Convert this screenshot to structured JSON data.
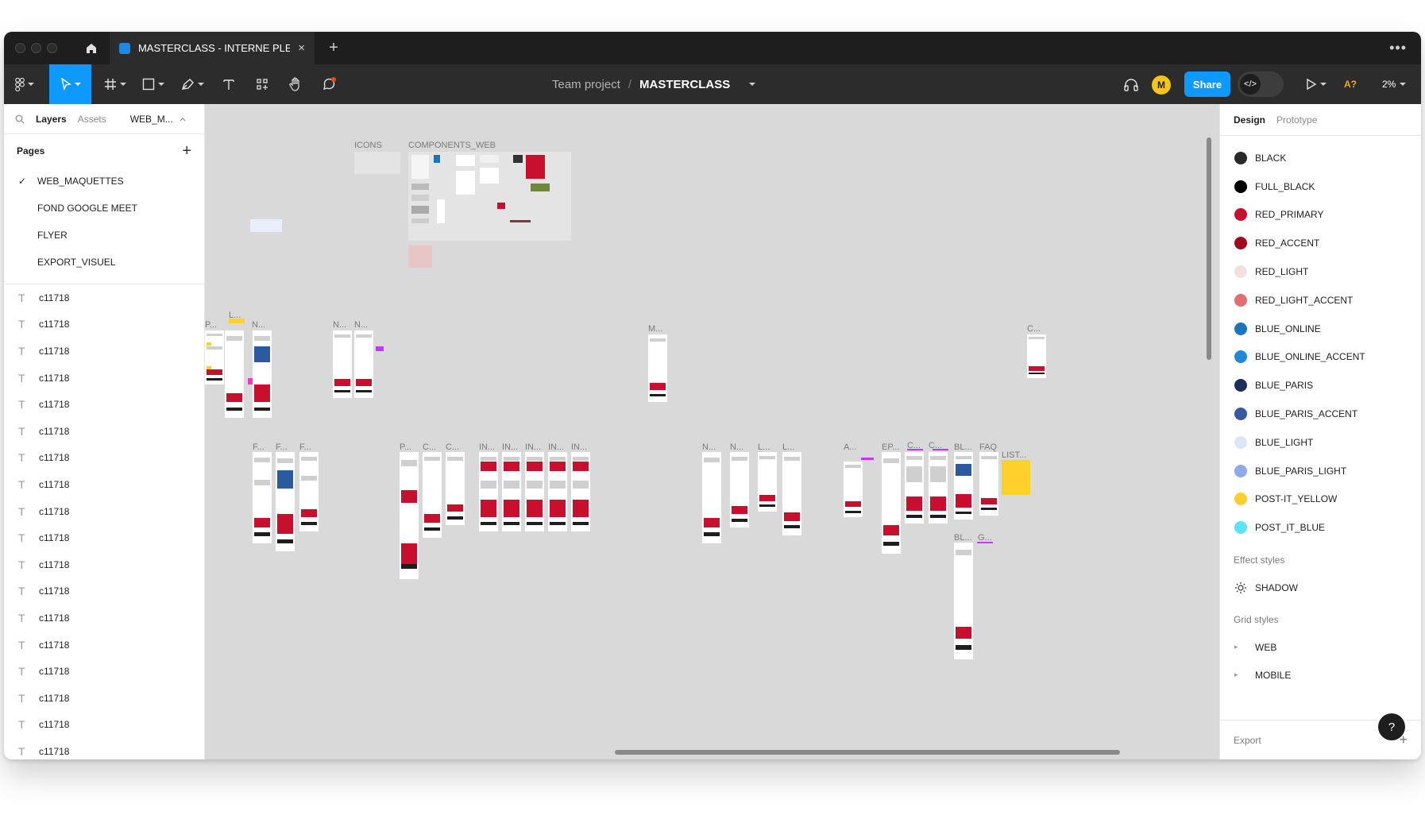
{
  "tab": {
    "title": "MASTERCLASS - INTERNE PLEASE",
    "close": "×",
    "new_tab": "+"
  },
  "titlebar": {
    "more": "•••"
  },
  "breadcrumb": {
    "team": "Team project",
    "separator": "/",
    "file": "MASTERCLASS"
  },
  "toolbar": {
    "avatar_initial": "M",
    "share_label": "Share",
    "dev_mode_icon": "</>",
    "a_label": "A?",
    "zoom_label": "2%"
  },
  "left_panel": {
    "tabs": {
      "layers": "Layers",
      "assets": "Assets",
      "page_select": "WEB_M..."
    },
    "pages_title": "Pages",
    "pages_add": "+",
    "pages": [
      {
        "label": "WEB_MAQUETTES",
        "current": true
      },
      {
        "label": "FOND GOOGLE MEET",
        "current": false
      },
      {
        "label": "FLYER",
        "current": false
      },
      {
        "label": "EXPORT_VISUEL",
        "current": false
      }
    ],
    "layers": [
      "c11718",
      "c11718",
      "c11718",
      "c11718",
      "c11718",
      "c11718",
      "c11718",
      "c11718",
      "c11718",
      "c11718",
      "c11718",
      "c11718",
      "c11718",
      "c11718",
      "c11718",
      "c11718",
      "c11718",
      "c11718"
    ]
  },
  "canvas": {
    "labels": [
      "ICONS",
      "COMPONENTS_WEB",
      "P...",
      "L...",
      "N...",
      "N...",
      "N...",
      "M...",
      "C...",
      "F...",
      "F...",
      "F...",
      "P...",
      "C...",
      "C...",
      "IN...",
      "IN...",
      "IN...",
      "IN...",
      "IN...",
      "N...",
      "N...",
      "L...",
      "L...",
      "A...",
      "EP...",
      "C...",
      "C...",
      "BL...",
      "FAQ",
      "LIST...",
      "BL...",
      "G..."
    ]
  },
  "right_panel": {
    "tabs": {
      "design": "Design",
      "prototype": "Prototype"
    },
    "colors": [
      {
        "name": "BLACK",
        "hex": "#2a2a2a"
      },
      {
        "name": "FULL_BLACK",
        "hex": "#000000"
      },
      {
        "name": "RED_PRIMARY",
        "hex": "#c8102e"
      },
      {
        "name": "RED_ACCENT",
        "hex": "#9e0b1f"
      },
      {
        "name": "RED_LIGHT",
        "hex": "#f7dede"
      },
      {
        "name": "RED_LIGHT_ACCENT",
        "hex": "#e07070"
      },
      {
        "name": "BLUE_ONLINE",
        "hex": "#1b75bc"
      },
      {
        "name": "BLUE_ONLINE_ACCENT",
        "hex": "#2389d6"
      },
      {
        "name": "BLUE_PARIS",
        "hex": "#1c2f5c"
      },
      {
        "name": "BLUE_PARIS_ACCENT",
        "hex": "#3a5aa0"
      },
      {
        "name": "BLUE_LIGHT",
        "hex": "#dbe6fb"
      },
      {
        "name": "BLUE_PARIS_LIGHT",
        "hex": "#8fa8ee"
      },
      {
        "name": "POST-IT_YELLOW",
        "hex": "#ffd02b"
      },
      {
        "name": "POST_IT_BLUE",
        "hex": "#5ce3ff"
      }
    ],
    "effect_styles_title": "Effect styles",
    "effect_styles": [
      "SHADOW"
    ],
    "grid_styles_title": "Grid styles",
    "grid_styles": [
      "WEB",
      "MOBILE"
    ],
    "export_label": "Export",
    "export_add": "+"
  },
  "help": {
    "label": "?"
  }
}
